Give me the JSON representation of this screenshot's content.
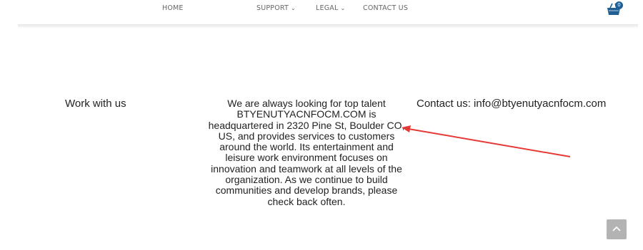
{
  "nav": {
    "items": [
      {
        "label": "HOME",
        "has_dropdown": false
      },
      {
        "label": "SUPPORT",
        "has_dropdown": true
      },
      {
        "label": "LEGAL",
        "has_dropdown": true
      },
      {
        "label": "CONTACT US",
        "has_dropdown": false
      }
    ],
    "cart_count": "0"
  },
  "content": {
    "work_title": "Work with us",
    "paragraph": "We are always looking for top talent BTYENUTYACNFOCM.COM is headquartered in 2320 Pine St, Boulder CO,    US, and provides services to customers around the world. Its entertainment and leisure work environment focuses on innovation and teamwork at all levels of the organization. As we continue to build communities and develop brands, please check back often.",
    "contact": "Contact us: info@btyenutyacnfocm.com"
  },
  "icons": {
    "cart": "shopping-cart-icon",
    "scroll_top": "chevron-up-icon",
    "annotation": "red-arrow"
  },
  "colors": {
    "nav_text": "#666666",
    "badge": "#1f5f93",
    "annotation_arrow": "#e53935",
    "scroll_button": "#b3b3b3"
  }
}
